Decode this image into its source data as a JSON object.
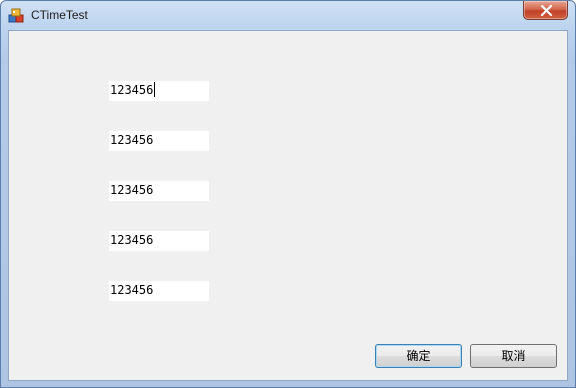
{
  "window": {
    "title": "CTimeTest",
    "icon": "app-icon"
  },
  "fields": [
    {
      "value": "123456",
      "focused": true
    },
    {
      "value": "123456",
      "focused": false
    },
    {
      "value": "123456",
      "focused": false
    },
    {
      "value": "123456",
      "focused": false
    },
    {
      "value": "123456",
      "focused": false
    }
  ],
  "buttons": {
    "ok_label": "确定",
    "cancel_label": "取消"
  },
  "colors": {
    "client_bg": "#f0f0f0",
    "frame": "#b9d1ea",
    "close_button": "#c7452d"
  }
}
